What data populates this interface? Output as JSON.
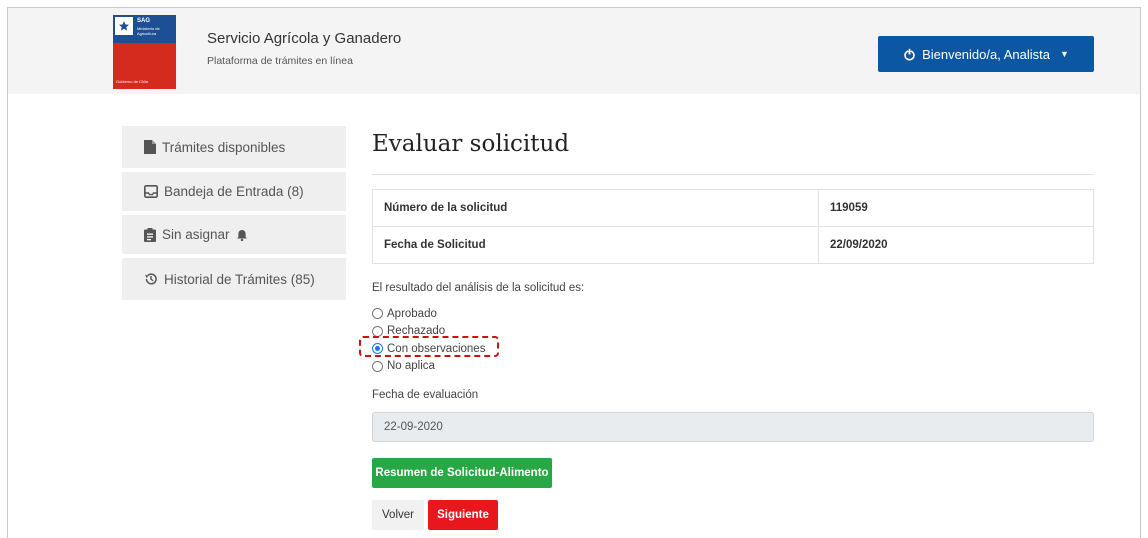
{
  "header": {
    "logo": {
      "acronym": "SAG",
      "ministry": "Ministerio de Agricultura",
      "government": "Gobierno de Chile"
    },
    "org_name": "Servicio Agrícola y Ganadero",
    "org_subtitle": "Plataforma de trámites en línea",
    "user_button_label": "Bienvenido/a, Analista"
  },
  "sidebar": {
    "items": [
      {
        "label": "Trámites disponibles",
        "icon": "file-icon"
      },
      {
        "label": "Bandeja de Entrada (8)",
        "icon": "inbox-icon"
      },
      {
        "label": "Sin asignar",
        "icon": "clipboard-icon",
        "extra_icon": "bell-icon"
      },
      {
        "label": "Historial de Trámites (85)",
        "icon": "history-icon"
      }
    ]
  },
  "main": {
    "title": "Evaluar solicitud",
    "info_table": [
      {
        "label": "Número de la solicitud",
        "value": "119059"
      },
      {
        "label": "Fecha de Solicitud",
        "value": "22/09/2020"
      }
    ],
    "question": "El resultado del análisis de la solicitud es:",
    "options": [
      {
        "label": "Aprobado",
        "checked": false
      },
      {
        "label": "Rechazado",
        "checked": false
      },
      {
        "label": "Con observaciones",
        "checked": true
      },
      {
        "label": "No aplica",
        "checked": false
      }
    ],
    "date_label": "Fecha de evaluación",
    "date_value": "22-09-2020",
    "summary_button": "Resumen de Solicitud-Alimento",
    "back_button": "Volver",
    "next_button": "Siguiente"
  },
  "colors": {
    "primary": "#0b57a4",
    "success": "#28a745",
    "danger": "#e8161d",
    "highlight": "#cc1111"
  }
}
